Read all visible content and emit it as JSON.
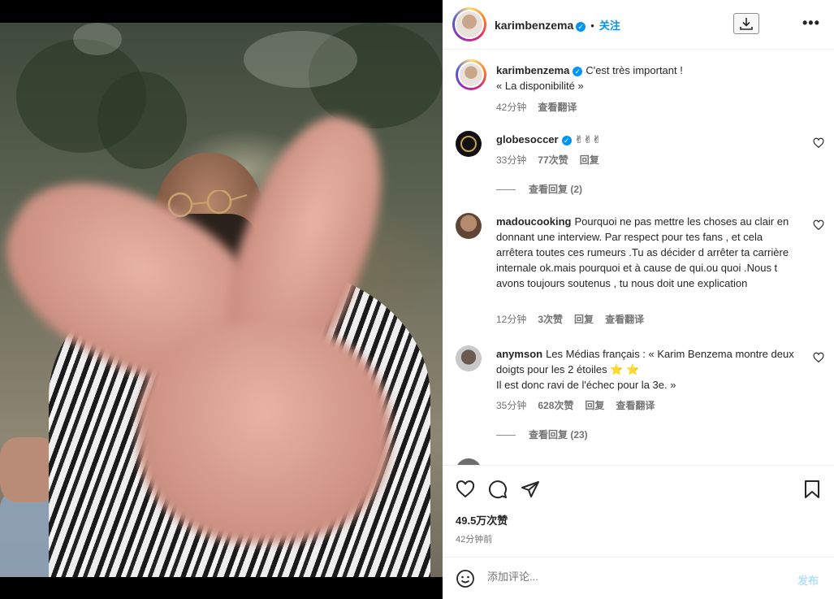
{
  "post": {
    "author": "karimbenzema",
    "follow_label": "关注",
    "dot": "•",
    "caption_line1": "C'est très important !",
    "caption_line2": "« La disponibilité »",
    "caption_time": "42分钟",
    "caption_translate": "查看翻译"
  },
  "comments": [
    {
      "user": "globesoccer",
      "verified": true,
      "text": "✌✌✌",
      "time": "33分钟",
      "likes": "77次赞",
      "reply": "回复",
      "view_replies": "查看回复 (2)"
    },
    {
      "user": "madoucooking",
      "text": "Pourquoi ne pas mettre les choses au clair en donnant une interview. Par respect pour tes fans , et cela arrêtera toutes ces rumeurs .Tu as décider d arrêter ta carrière internale ok.mais pourquoi et à cause de qui.ou quoi .Nous t avons toujours soutenus , tu nous doit une explication",
      "time": "12分钟",
      "likes": "3次赞",
      "reply": "回复",
      "translate": "查看翻译"
    },
    {
      "user": "anymson",
      "text_line1": "Les Médias français : « Karim Benzema montre deux doigts pour les 2 étoiles ⭐ ⭐",
      "text_line2": "Il est donc ravi de l'échec pour la 3e. »",
      "time": "35分钟",
      "likes": "628次赞",
      "reply": "回复",
      "translate": "查看翻译",
      "view_replies": "查看回复 (23)"
    }
  ],
  "footer": {
    "likes": "49.5万次赞",
    "time": "42分钟前",
    "comment_placeholder": "添加评论...",
    "post_label": "发布"
  },
  "icons": {
    "like": "heart-icon",
    "comment": "comment-icon",
    "share": "paper-plane-icon",
    "save": "bookmark-icon",
    "emoji": "smiley-icon",
    "download": "download-icon",
    "more": "more-icon"
  },
  "colors": {
    "accent": "#0095f6",
    "muted": "#737373",
    "post_disabled": "#b2dffc"
  }
}
